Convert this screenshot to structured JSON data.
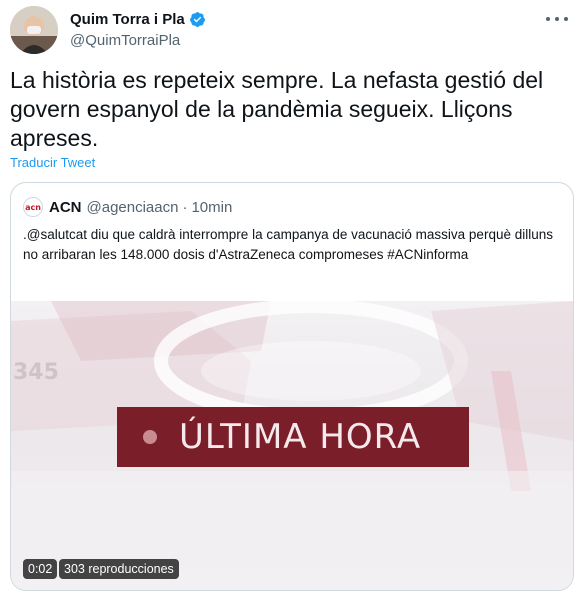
{
  "author": {
    "name": "Quim Torra i Pla",
    "handle": "@QuimTorraiPla",
    "verified_icon": "verified-badge-icon"
  },
  "tweet": {
    "text": "La història es repeteix sempre. La nefasta gestió del govern espanyol de la pandèmia segueix. Lliçons apreses.",
    "translate_label": "Traducir Tweet"
  },
  "quoted": {
    "avatar_text": "acn",
    "name": "ACN",
    "handle": "@agenciaacn",
    "separator": "·",
    "time": "10min",
    "text": ".@salutcat diu que caldrà interrompre la campanya de vacunació massiva perquè dilluns no arribaran les 148.000 dosis d'AstraZeneca compromeses #ACNinforma",
    "video": {
      "banner_text": "ÚLTIMA HORA",
      "background_number": "345",
      "duration": "0:02",
      "views": "303 reproducciones"
    }
  },
  "colors": {
    "link": "#1d9bf0",
    "banner": "#7a1e2a",
    "muted": "#536471"
  }
}
